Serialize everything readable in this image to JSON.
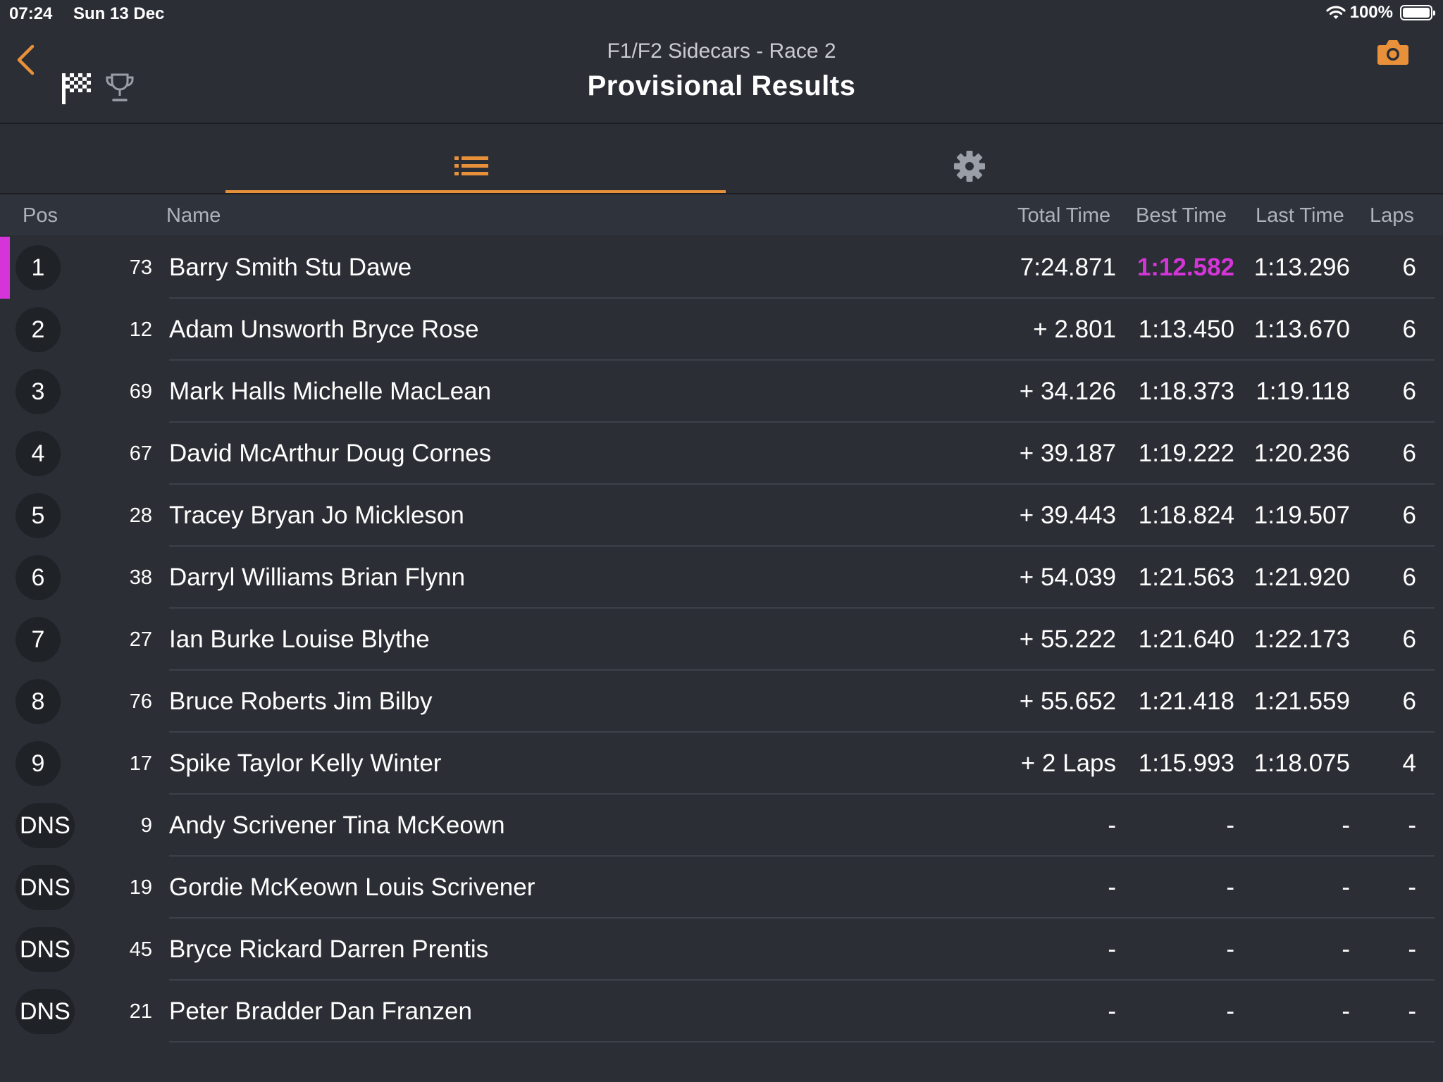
{
  "status_bar": {
    "time": "07:24",
    "date": "Sun 13 Dec",
    "battery": "100%"
  },
  "header": {
    "subtitle": "F1/F2 Sidecars - Race 2",
    "title": "Provisional Results"
  },
  "colors": {
    "accent": "#e8913a",
    "fastest": "#d535d8",
    "background": "#2b2e35"
  },
  "columns": {
    "pos": "Pos",
    "name": "Name",
    "total": "Total Time",
    "best": "Best Time",
    "last": "Last Time",
    "laps": "Laps"
  },
  "results": [
    {
      "pos": "1",
      "num": "73",
      "name": "Barry Smith Stu Dawe",
      "total": "7:24.871",
      "best": "1:12.582",
      "last": "1:13.296",
      "laps": "6",
      "fastest": true
    },
    {
      "pos": "2",
      "num": "12",
      "name": "Adam Unsworth Bryce Rose",
      "total": "+ 2.801",
      "best": "1:13.450",
      "last": "1:13.670",
      "laps": "6"
    },
    {
      "pos": "3",
      "num": "69",
      "name": "Mark Halls Michelle MacLean",
      "total": "+ 34.126",
      "best": "1:18.373",
      "last": "1:19.118",
      "laps": "6"
    },
    {
      "pos": "4",
      "num": "67",
      "name": "David McArthur Doug Cornes",
      "total": "+ 39.187",
      "best": "1:19.222",
      "last": "1:20.236",
      "laps": "6"
    },
    {
      "pos": "5",
      "num": "28",
      "name": "Tracey Bryan Jo Mickleson",
      "total": "+ 39.443",
      "best": "1:18.824",
      "last": "1:19.507",
      "laps": "6"
    },
    {
      "pos": "6",
      "num": "38",
      "name": "Darryl Williams Brian Flynn",
      "total": "+ 54.039",
      "best": "1:21.563",
      "last": "1:21.920",
      "laps": "6"
    },
    {
      "pos": "7",
      "num": "27",
      "name": "Ian Burke Louise Blythe",
      "total": "+ 55.222",
      "best": "1:21.640",
      "last": "1:22.173",
      "laps": "6"
    },
    {
      "pos": "8",
      "num": "76",
      "name": "Bruce Roberts Jim Bilby",
      "total": "+ 55.652",
      "best": "1:21.418",
      "last": "1:21.559",
      "laps": "6"
    },
    {
      "pos": "9",
      "num": "17",
      "name": "Spike Taylor Kelly Winter",
      "total": "+ 2 Laps",
      "best": "1:15.993",
      "last": "1:18.075",
      "laps": "4"
    },
    {
      "pos": "DNS",
      "num": "9",
      "name": "Andy Scrivener Tina McKeown",
      "total": "-",
      "best": "-",
      "last": "-",
      "laps": "-"
    },
    {
      "pos": "DNS",
      "num": "19",
      "name": "Gordie McKeown Louis Scrivener",
      "total": "-",
      "best": "-",
      "last": "-",
      "laps": "-"
    },
    {
      "pos": "DNS",
      "num": "45",
      "name": "Bryce Rickard Darren Prentis",
      "total": "-",
      "best": "-",
      "last": "-",
      "laps": "-"
    },
    {
      "pos": "DNS",
      "num": "21",
      "name": "Peter Bradder Dan Franzen",
      "total": "-",
      "best": "-",
      "last": "-",
      "laps": "-"
    }
  ]
}
